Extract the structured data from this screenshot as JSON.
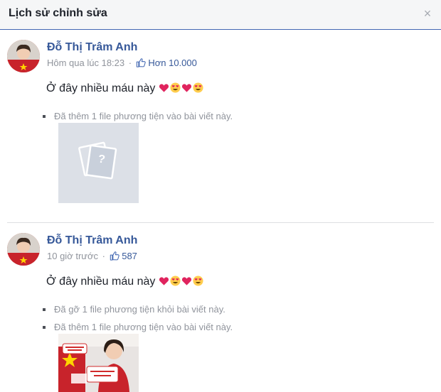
{
  "dialog": {
    "title": "Lịch sử chỉnh sửa",
    "close_symbol": "×"
  },
  "entries": [
    {
      "author": "Đỗ Thị Trâm Anh",
      "time": "Hôm qua lúc 18:23",
      "separator": "·",
      "likes": "Hơn 10.000",
      "text": "Ở đây nhiều máu này",
      "emojis": [
        "heart",
        "heart-eyes",
        "heart",
        "heart-eyes"
      ],
      "changes": [
        "Đã thêm 1 file phương tiện vào bài viết này."
      ],
      "media": "placeholder-icon"
    },
    {
      "author": "Đỗ Thị Trâm Anh",
      "time": "10 giờ trước",
      "separator": "·",
      "likes": "587",
      "text": "Ở đây nhiều máu này",
      "emojis": [
        "heart",
        "heart-eyes",
        "heart",
        "heart-eyes"
      ],
      "changes": [
        "Đã gỡ 1 file phương tiện khỏi bài viết này.",
        "Đã thêm 1 file phương tiện vào bài viết này."
      ],
      "media": "photo-thumbnail"
    }
  ],
  "colors": {
    "link": "#365899",
    "muted": "#90949c",
    "header_border": "#4267b2",
    "heart": "#e0245e",
    "emoji_yellow": "#ffcc4d"
  },
  "icons": [
    "close-icon",
    "like-icon",
    "heart-emoji",
    "heart-eyes-emoji",
    "image-placeholder-icon"
  ]
}
